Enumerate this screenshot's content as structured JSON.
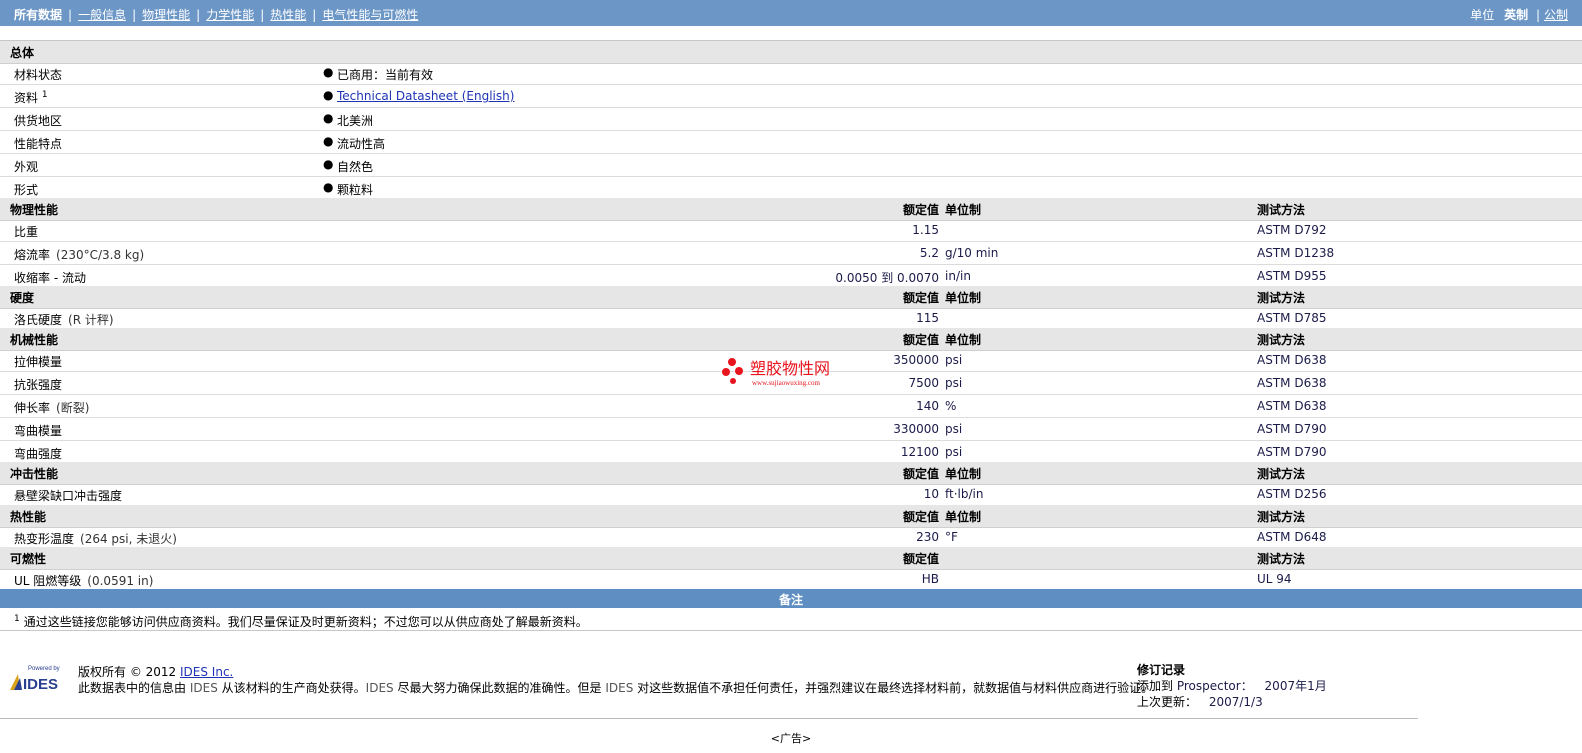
{
  "nav": {
    "items": [
      {
        "label": "所有数据",
        "active": true
      },
      {
        "label": "一般信息"
      },
      {
        "label": "物理性能"
      },
      {
        "label": "力学性能"
      },
      {
        "label": "热性能"
      },
      {
        "label": "电气性能与可燃性"
      }
    ],
    "units_label": "单位",
    "unit_english": "英制",
    "unit_metric": "公制"
  },
  "general": {
    "title": "总体",
    "rows": [
      {
        "label": "材料状态",
        "value": "已商用：当前有效"
      },
      {
        "label": "资料",
        "sup": "1",
        "value": "Technical Datasheet (English)"
      },
      {
        "label": "供货地区",
        "value": "北美洲"
      },
      {
        "label": "性能特点",
        "value": "流动性高"
      },
      {
        "label": "外观",
        "value": "自然色"
      },
      {
        "label": "形式",
        "value": "颗粒料"
      }
    ]
  },
  "columns": {
    "nominal": "额定值",
    "unit": "单位制",
    "method": "测试方法"
  },
  "physical": {
    "title": "物理性能",
    "rows": [
      {
        "label": "比重",
        "cond": "",
        "value": "1.15",
        "unit": "",
        "method": "ASTM D792"
      },
      {
        "label": "熔流率",
        "cond": "(230°C/3.8 kg)",
        "value": "5.2",
        "unit": "g/10 min",
        "method": "ASTM D1238"
      },
      {
        "label": "收缩率 - 流动",
        "cond": "",
        "value": "0.0050 到  0.0070",
        "unit": "in/in",
        "method": "ASTM D955"
      }
    ]
  },
  "hardness": {
    "title": "硬度",
    "rows": [
      {
        "label": "洛氏硬度",
        "cond": "(R 计秤)",
        "value": "115",
        "unit": "",
        "method": "ASTM D785"
      }
    ]
  },
  "mechanical": {
    "title": "机械性能",
    "rows": [
      {
        "label": "拉伸模量",
        "cond": "",
        "value": "350000",
        "unit": "psi",
        "method": "ASTM D638"
      },
      {
        "label": "抗张强度",
        "cond": "",
        "value": "7500",
        "unit": "psi",
        "method": "ASTM D638"
      },
      {
        "label": "伸长率",
        "cond": "(断裂)",
        "value": "140",
        "unit": "%",
        "method": "ASTM D638"
      },
      {
        "label": "弯曲模量",
        "cond": "",
        "value": "330000",
        "unit": "psi",
        "method": "ASTM D790"
      },
      {
        "label": "弯曲强度",
        "cond": "",
        "value": "12100",
        "unit": "psi",
        "method": "ASTM D790"
      }
    ]
  },
  "impact": {
    "title": "冲击性能",
    "rows": [
      {
        "label": "悬壁梁缺口冲击强度",
        "cond": "",
        "value": "10",
        "unit": "ft·lb/in",
        "method": "ASTM D256"
      }
    ]
  },
  "thermal": {
    "title": "热性能",
    "rows": [
      {
        "label": "热变形温度",
        "cond": "(264 psi, 未退火)",
        "value": "230",
        "unit": "°F",
        "method": "ASTM D648"
      }
    ]
  },
  "flammability": {
    "title": "可燃性",
    "rows": [
      {
        "label": "UL 阻燃等级",
        "cond": "(0.0591 in)",
        "value": "HB",
        "unit": "",
        "method": "UL 94"
      }
    ]
  },
  "notes": {
    "title": "备注",
    "sup": "1",
    "text": "通过这些链接您能够访问供应商资料。我们尽量保证及时更新资料；不过您可以从供应商处了解最新资料。"
  },
  "footer": {
    "logo_top": "Powered by",
    "logo_brand": "IDES",
    "copyright": "版权所有 © 2012",
    "company_link": "IDES Inc.",
    "line2_a": "此数据表中的信息由",
    "ides": "IDES",
    "line2_b": "从该材料的生产商处获得。",
    "line2_c": "尽最大努力确保此数据的准确性。但是",
    "line2_d": "对这些数据值不承担任何责任，并强烈建议在最终选择材料前，就数据值与材料供应商进行验证。"
  },
  "revision": {
    "title": "修订记录",
    "added_label": "添加到",
    "added_target": "Prospector：",
    "added_value": "2007年1月",
    "updated_label": "上次更新：",
    "updated_value": "2007/1/3"
  },
  "watermark": {
    "cn": "塑胶物性网",
    "url": "www.sujiaowuxing.com"
  },
  "ad": "<广告>",
  "colors": {
    "topbar": "#6b96c6",
    "notes_header": "#5f8fc2",
    "link": "#1e34b4",
    "watermark_red": "#e8141e"
  }
}
